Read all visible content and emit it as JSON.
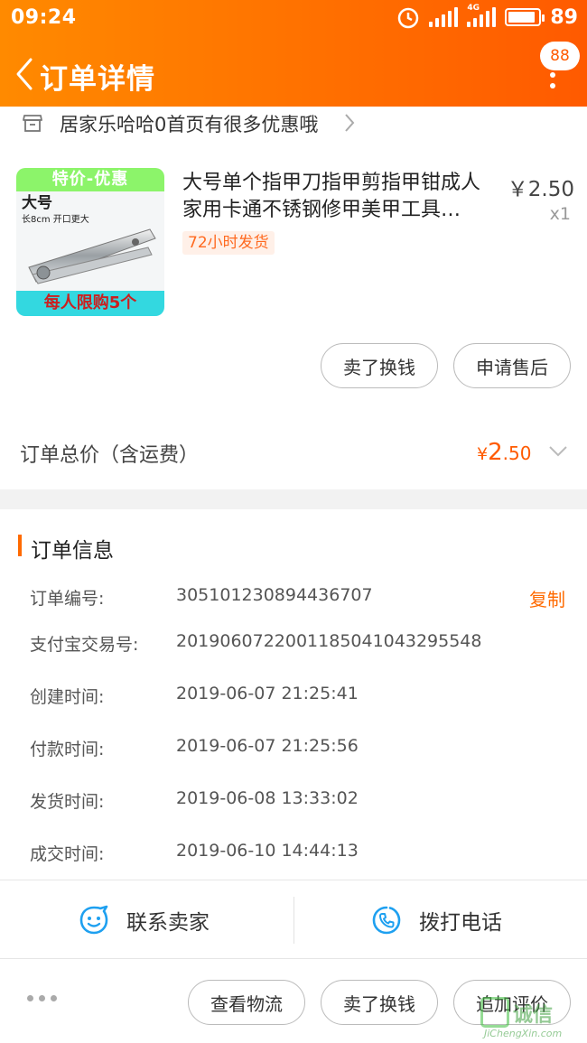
{
  "status_bar": {
    "time": "09:24",
    "network": "4G",
    "battery": "89",
    "battery_fraction": 0.89
  },
  "nav": {
    "title": "订单详情",
    "badge": "88"
  },
  "shop": {
    "name": "居家乐哈哈0首页有很多优惠哦"
  },
  "product": {
    "image_banner_top": "特价-优惠",
    "image_label_size": "大号",
    "image_label_spec": "长8cm  开口更大",
    "image_banner_bottom": "每人限购5个",
    "title": "大号单个指甲刀指甲剪指甲钳成人家用卡通不锈钢修甲美甲工具…",
    "price": "￥2.50",
    "quantity": "x1",
    "shipping_tag": "72小时发货"
  },
  "item_actions": {
    "sell_label": "卖了换钱",
    "after_sale_label": "申请售后"
  },
  "total": {
    "label": "订单总价（含运费）",
    "currency": "¥",
    "integer": "2",
    "decimal": ".50"
  },
  "order_info": {
    "title": "订单信息",
    "copy_label": "复制",
    "rows": [
      {
        "key": "订单编号:",
        "value": "305101230894436707"
      },
      {
        "key": "支付宝交易号:",
        "value": "2019060722001185041043295548"
      },
      {
        "key": "创建时间:",
        "value": "2019-06-07 21:25:41"
      },
      {
        "key": "付款时间:",
        "value": "2019-06-07 21:25:56"
      },
      {
        "key": "发货时间:",
        "value": "2019-06-08 13:33:02"
      },
      {
        "key": "成交时间:",
        "value": "2019-06-10 14:44:13"
      }
    ]
  },
  "contact": {
    "seller_label": "联系卖家",
    "phone_label": "拨打电话"
  },
  "bottom_actions": {
    "logistics_label": "查看物流",
    "sell_label": "卖了换钱",
    "review_label": "追加评价"
  },
  "watermark": {
    "text": "诚信",
    "sub": "JiChengXin.com"
  },
  "colors": {
    "accent": "#ff5a00",
    "header_start": "#ff8a00",
    "header_end": "#ff5a00"
  }
}
